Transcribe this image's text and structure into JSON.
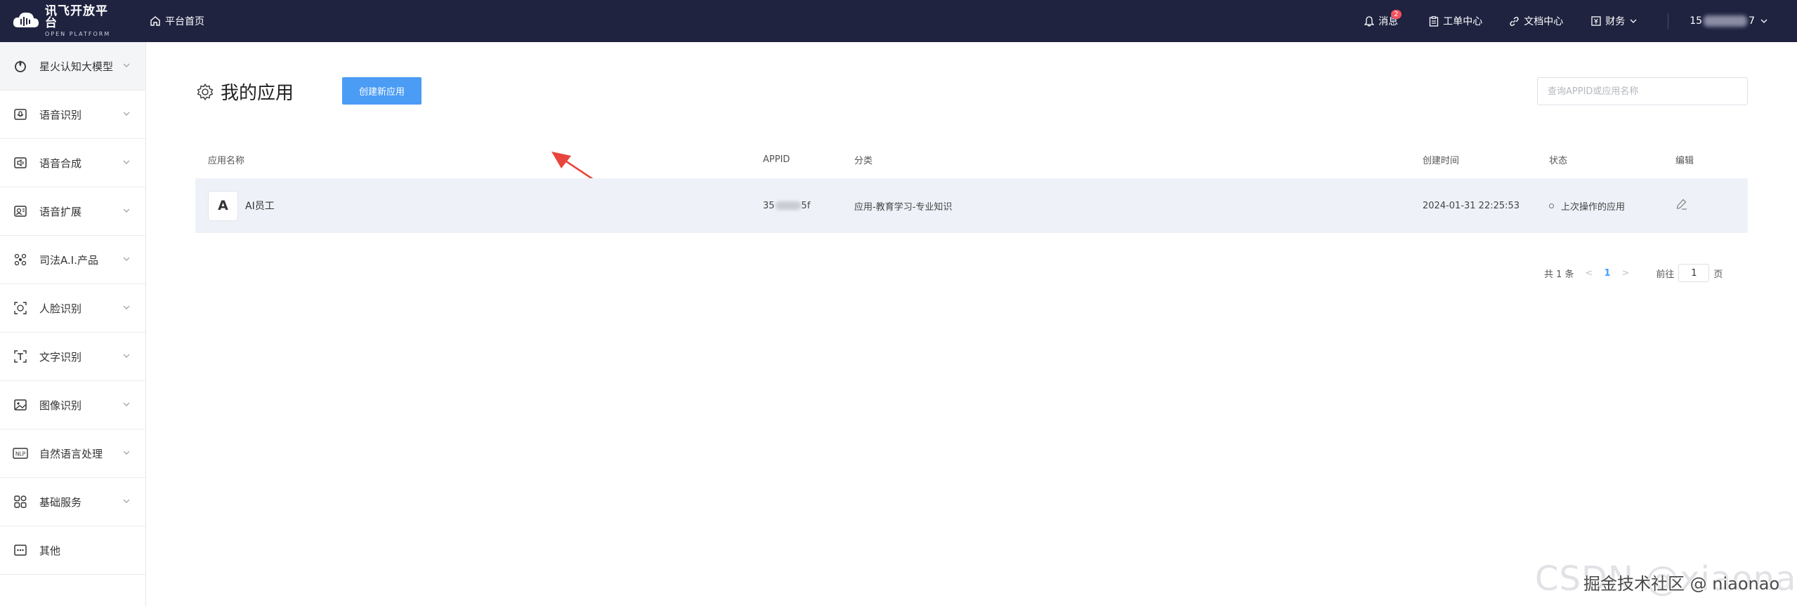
{
  "brand": {
    "name": "讯飞开放平台",
    "sub": "OPEN PLATFORM"
  },
  "topbar": {
    "home": "平台首页",
    "messages": "消息",
    "messages_badge": "2",
    "tickets": "工单中心",
    "docs": "文档中心",
    "finance": "财务",
    "user_prefix": "15",
    "user_suffix": "7"
  },
  "sidebar": {
    "items": [
      {
        "label": "星火认知大模型",
        "icon": "spark-icon"
      },
      {
        "label": "语音识别",
        "icon": "speech-recognition-icon"
      },
      {
        "label": "语音合成",
        "icon": "speech-synthesis-icon"
      },
      {
        "label": "语音扩展",
        "icon": "speech-extension-icon"
      },
      {
        "label": "司法A.I.产品",
        "icon": "legal-ai-icon"
      },
      {
        "label": "人脸识别",
        "icon": "face-recognition-icon"
      },
      {
        "label": "文字识别",
        "icon": "text-recognition-icon"
      },
      {
        "label": "图像识别",
        "icon": "image-recognition-icon"
      },
      {
        "label": "自然语言处理",
        "icon": "nlp-icon"
      },
      {
        "label": "基础服务",
        "icon": "basic-service-icon"
      },
      {
        "label": "其他",
        "icon": "more-icon"
      }
    ]
  },
  "main": {
    "title": "我的应用",
    "create_button": "创建新应用",
    "search_placeholder": "查询APPID或应用名称",
    "columns": {
      "name": "应用名称",
      "appid": "APPID",
      "category": "分类",
      "created": "创建时间",
      "status": "状态",
      "edit": "编辑"
    },
    "rows": [
      {
        "avatar": "A",
        "name": "AI员工",
        "appid_prefix": "35",
        "appid_suffix": "5f",
        "category": "应用-教育学习-专业知识",
        "created": "2024-01-31 22:25:53",
        "status": "上次操作的应用"
      }
    ],
    "pagination": {
      "total": "共 1 条",
      "prev": "<",
      "current": "1",
      "next": ">",
      "goto_label": "前往",
      "goto_value": "1",
      "page_unit": "页"
    }
  },
  "watermark": {
    "csdn": "CSDN @xiaonao",
    "juejin": "掘金技术社区 @ niaonao"
  },
  "colors": {
    "topbar_bg": "#1f2340",
    "primary_button": "#4a9cf5",
    "row_bg": "#eef2f8",
    "annotation_arrow": "#e8453c"
  }
}
